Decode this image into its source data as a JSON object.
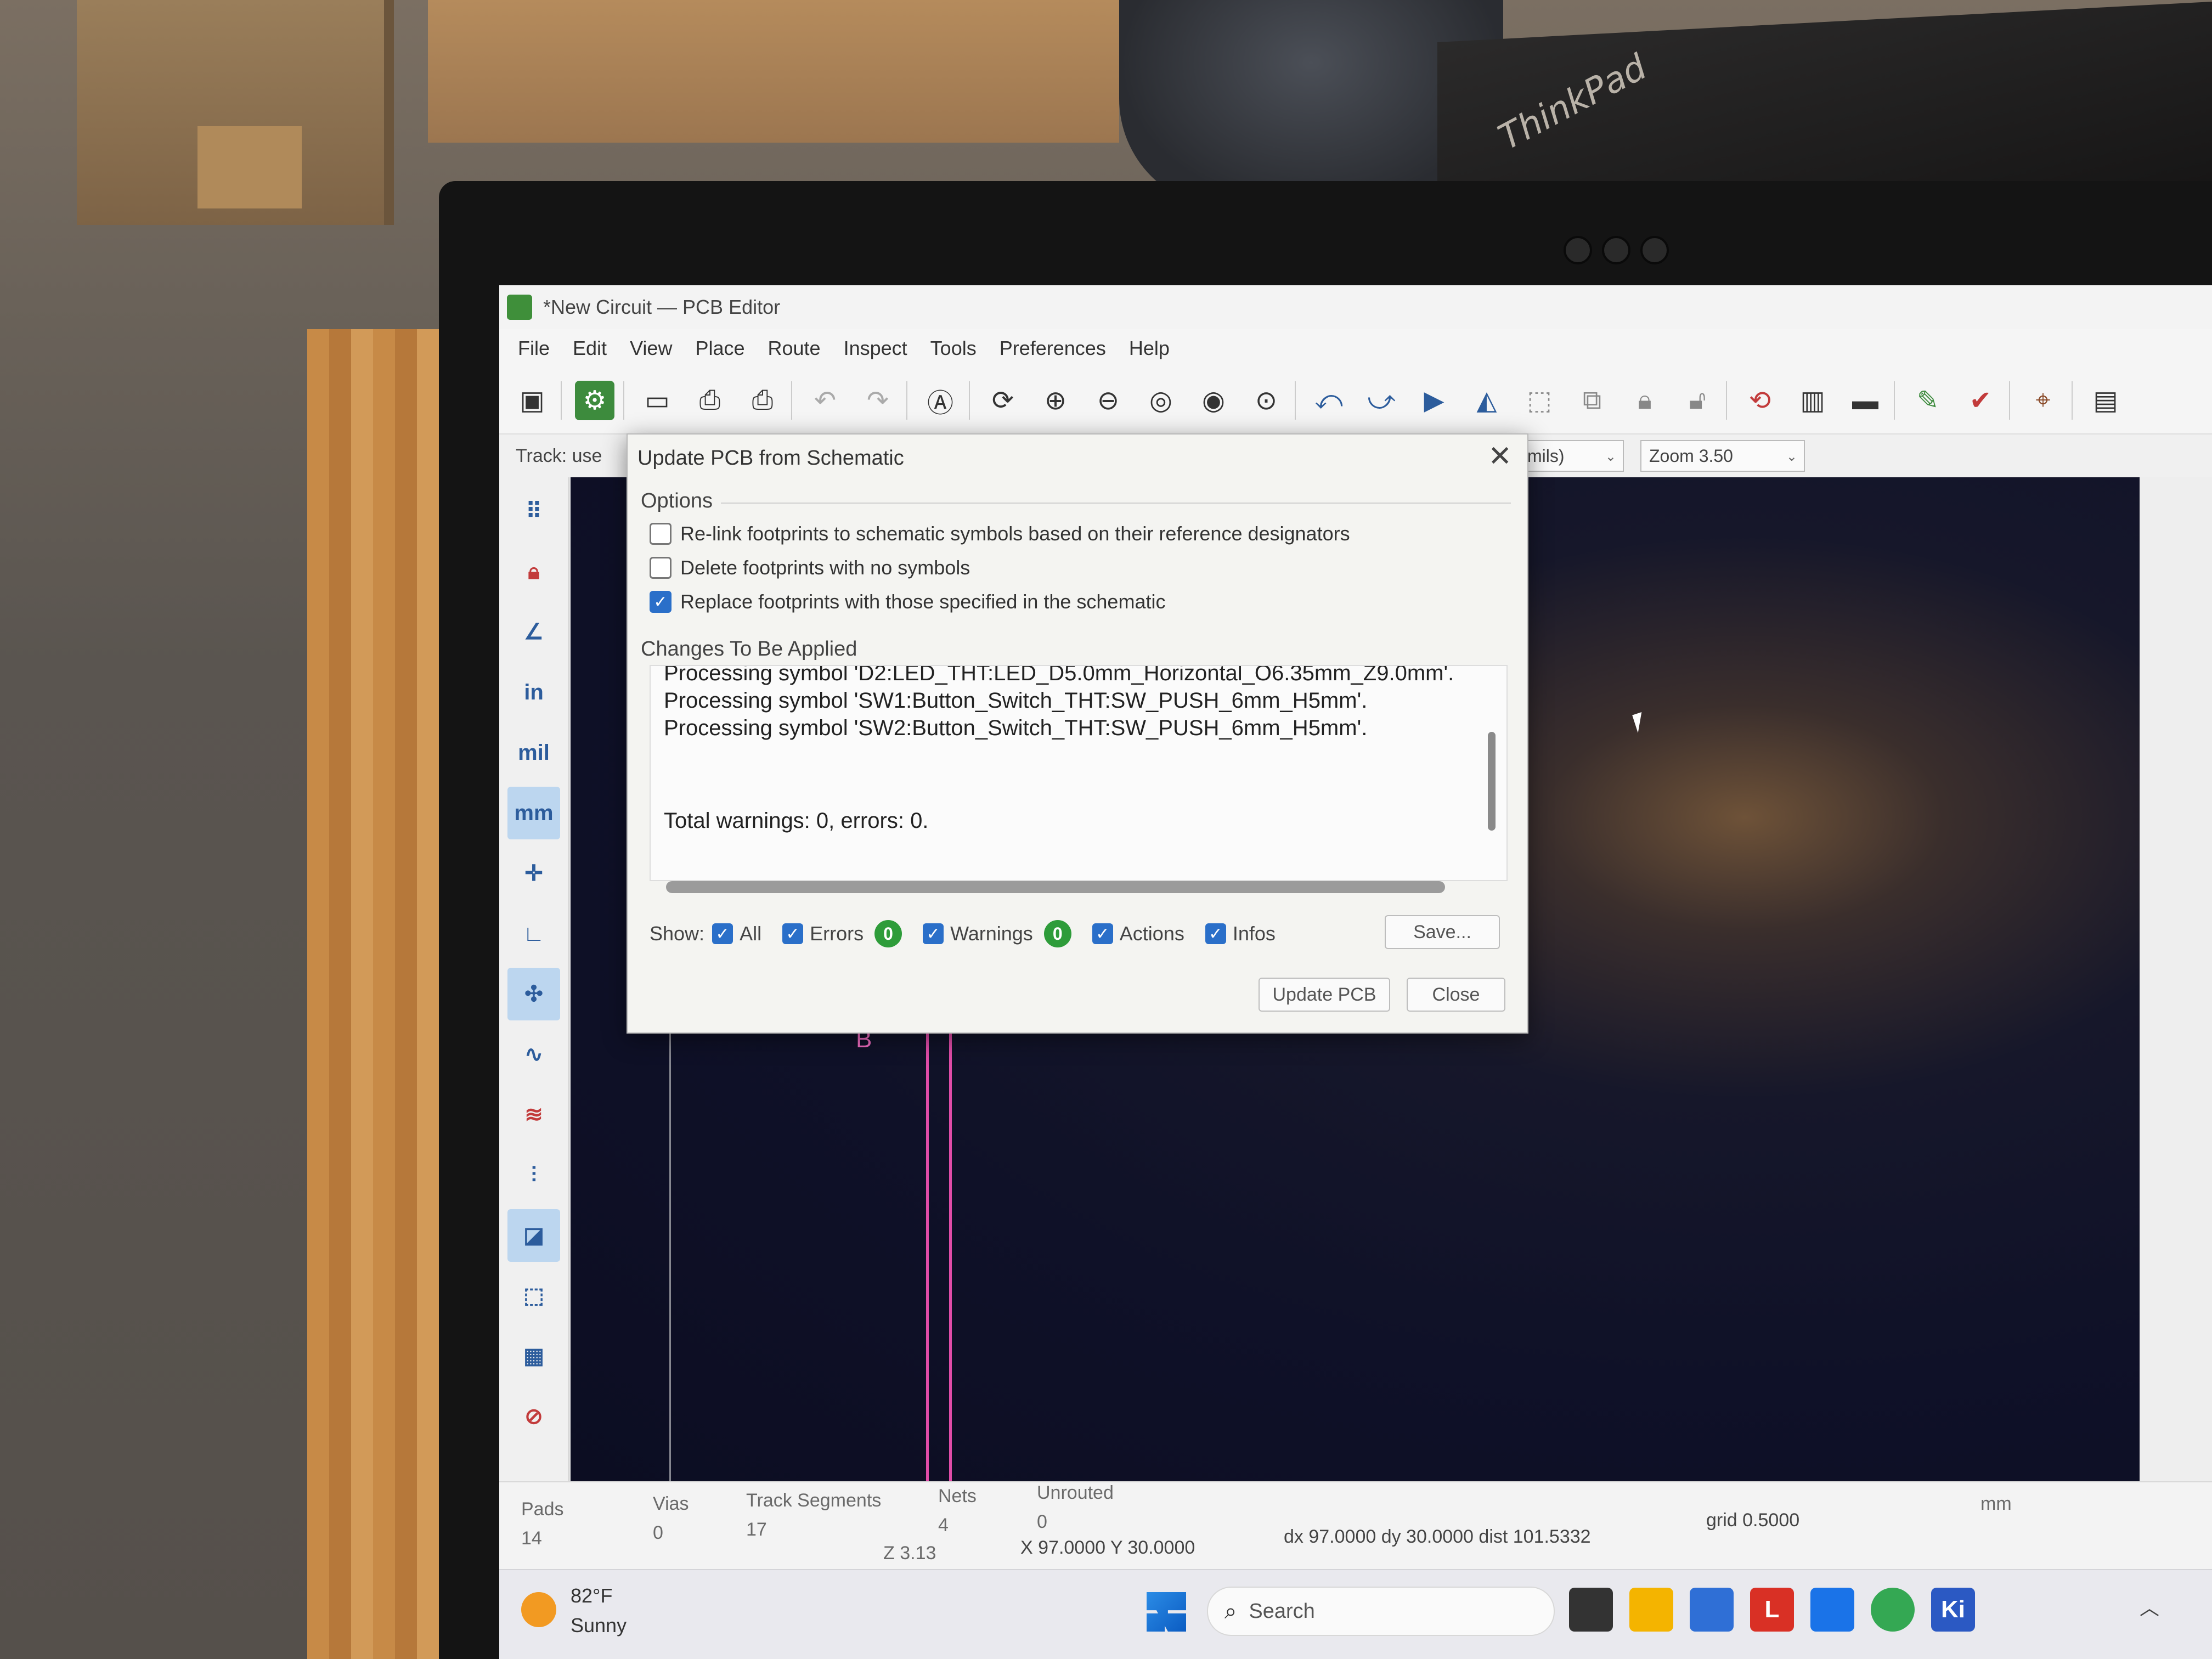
{
  "window": {
    "title": "*New Circuit — PCB Editor"
  },
  "menu": [
    "File",
    "Edit",
    "View",
    "Place",
    "Route",
    "Inspect",
    "Tools",
    "Preferences",
    "Help"
  ],
  "toolbar": {
    "icons": [
      "save-icon",
      "board-setup-icon",
      "page-settings-icon",
      "print-icon",
      "plot-icon",
      "undo-icon",
      "redo-icon",
      "find-icon",
      "refresh-icon",
      "zoom-in-icon",
      "zoom-out-icon",
      "zoom-fit-icon",
      "zoom-objects-icon",
      "zoom-selection-icon",
      "rotate-ccw-icon",
      "rotate-cw-icon",
      "flip-icon",
      "mirror-icon",
      "group-icon",
      "ungroup-icon",
      "lock-icon",
      "unlock-icon",
      "update-pcb-icon",
      "footprint-editor-icon",
      "footprint-browser-icon",
      "netlist-icon",
      "drc-icon",
      "schematic-icon",
      "scripting-console-icon"
    ]
  },
  "options_bar": {
    "track_label": "Track: use",
    "units_value": "mils)",
    "zoom_value": "Zoom 3.50"
  },
  "left_toolbar": {
    "items": [
      "grid-icon",
      "lock-icon",
      "polar-coords-icon",
      "in",
      "mil",
      "mm",
      "cursor-icon",
      "measure-icon",
      "ratsnest-icon",
      "curved-ratsnest-icon",
      "net-highlight-icon",
      "track-outline-icon",
      "via-icon",
      "zone-icon",
      "zone-outline-icon",
      "drc-marker-icon"
    ]
  },
  "canvas": {
    "layer_label": "B"
  },
  "dialog": {
    "title": "Update PCB from Schematic",
    "options_label": "Options",
    "options": [
      {
        "label": "Re-link footprints to schematic symbols based on their reference designators",
        "checked": false
      },
      {
        "label": "Delete footprints with no symbols",
        "checked": false
      },
      {
        "label": "Replace footprints with those specified in the schematic",
        "checked": true
      }
    ],
    "changes_label": "Changes To Be Applied",
    "log": [
      "Processing symbol 'D2:LED_THT:LED_D5.0mm_Horizontal_O6.35mm_Z9.0mm'.",
      "Processing symbol 'SW1:Button_Switch_THT:SW_PUSH_6mm_H5mm'.",
      "Processing symbol 'SW2:Button_Switch_THT:SW_PUSH_6mm_H5mm'."
    ],
    "total": "Total warnings: 0, errors: 0.",
    "show_label": "Show:",
    "filters": {
      "all": {
        "label": "All",
        "checked": true
      },
      "errors": {
        "label": "Errors",
        "checked": true,
        "count": "0"
      },
      "warnings": {
        "label": "Warnings",
        "checked": true,
        "count": "0"
      },
      "actions": {
        "label": "Actions",
        "checked": true
      },
      "infos": {
        "label": "Infos",
        "checked": true
      }
    },
    "save_label": "Save...",
    "update_label": "Update PCB",
    "close_label": "Close"
  },
  "status": {
    "pads_label": "Pads",
    "pads": "14",
    "vias_label": "Vias",
    "vias": "0",
    "tracks_label": "Track Segments",
    "tracks": "17",
    "nets_label": "Nets",
    "nets": "4",
    "unrouted_label": "Unrouted",
    "unrouted": "0",
    "z": "Z 3.13",
    "xy": "X 97.0000  Y 30.0000",
    "delta": "dx 97.0000  dy 30.0000  dist 101.5332",
    "grid": "grid 0.5000",
    "units": "mm"
  },
  "taskbar": {
    "weather_temp": "82°F",
    "weather_cond": "Sunny",
    "search_placeholder": "Search",
    "apps": [
      {
        "name": "task-view-icon",
        "color": "#333333"
      },
      {
        "name": "file-explorer-icon",
        "color": "#f4b400"
      },
      {
        "name": "store-icon",
        "color": "#2f6fd6"
      },
      {
        "name": "app-l-icon",
        "color": "#d93025",
        "glyph": "L"
      },
      {
        "name": "outlook-icon",
        "color": "#1a73e8"
      },
      {
        "name": "chrome-icon",
        "color": "#34a853"
      },
      {
        "name": "kicad-icon",
        "color": "#2b59c3",
        "glyph": "Ki"
      }
    ]
  },
  "photo": {
    "laptop_brand": "ThinkPad"
  },
  "colors": {
    "accent": "#2a6fc9",
    "badge": "#2e9c3a",
    "trace": "#e04ca8",
    "canvas": "#0f1128"
  }
}
